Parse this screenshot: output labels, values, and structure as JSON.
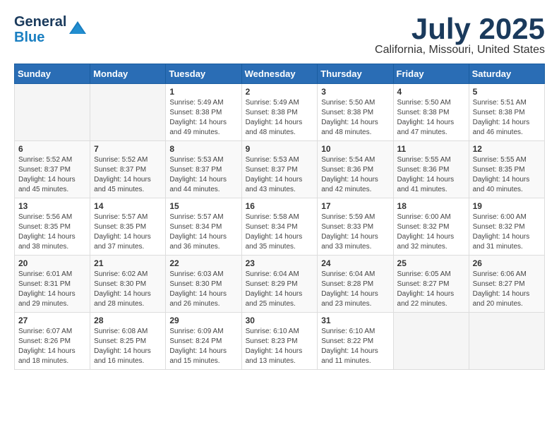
{
  "app": {
    "name": "GeneralBlue",
    "name_part1": "General",
    "name_part2": "Blue"
  },
  "title": {
    "month_year": "July 2025",
    "location": "California, Missouri, United States"
  },
  "weekdays": [
    "Sunday",
    "Monday",
    "Tuesday",
    "Wednesday",
    "Thursday",
    "Friday",
    "Saturday"
  ],
  "weeks": [
    [
      {
        "day": "",
        "info": ""
      },
      {
        "day": "",
        "info": ""
      },
      {
        "day": "1",
        "info": "Sunrise: 5:49 AM\nSunset: 8:38 PM\nDaylight: 14 hours and 49 minutes."
      },
      {
        "day": "2",
        "info": "Sunrise: 5:49 AM\nSunset: 8:38 PM\nDaylight: 14 hours and 48 minutes."
      },
      {
        "day": "3",
        "info": "Sunrise: 5:50 AM\nSunset: 8:38 PM\nDaylight: 14 hours and 48 minutes."
      },
      {
        "day": "4",
        "info": "Sunrise: 5:50 AM\nSunset: 8:38 PM\nDaylight: 14 hours and 47 minutes."
      },
      {
        "day": "5",
        "info": "Sunrise: 5:51 AM\nSunset: 8:38 PM\nDaylight: 14 hours and 46 minutes."
      }
    ],
    [
      {
        "day": "6",
        "info": "Sunrise: 5:52 AM\nSunset: 8:37 PM\nDaylight: 14 hours and 45 minutes."
      },
      {
        "day": "7",
        "info": "Sunrise: 5:52 AM\nSunset: 8:37 PM\nDaylight: 14 hours and 45 minutes."
      },
      {
        "day": "8",
        "info": "Sunrise: 5:53 AM\nSunset: 8:37 PM\nDaylight: 14 hours and 44 minutes."
      },
      {
        "day": "9",
        "info": "Sunrise: 5:53 AM\nSunset: 8:37 PM\nDaylight: 14 hours and 43 minutes."
      },
      {
        "day": "10",
        "info": "Sunrise: 5:54 AM\nSunset: 8:36 PM\nDaylight: 14 hours and 42 minutes."
      },
      {
        "day": "11",
        "info": "Sunrise: 5:55 AM\nSunset: 8:36 PM\nDaylight: 14 hours and 41 minutes."
      },
      {
        "day": "12",
        "info": "Sunrise: 5:55 AM\nSunset: 8:35 PM\nDaylight: 14 hours and 40 minutes."
      }
    ],
    [
      {
        "day": "13",
        "info": "Sunrise: 5:56 AM\nSunset: 8:35 PM\nDaylight: 14 hours and 38 minutes."
      },
      {
        "day": "14",
        "info": "Sunrise: 5:57 AM\nSunset: 8:35 PM\nDaylight: 14 hours and 37 minutes."
      },
      {
        "day": "15",
        "info": "Sunrise: 5:57 AM\nSunset: 8:34 PM\nDaylight: 14 hours and 36 minutes."
      },
      {
        "day": "16",
        "info": "Sunrise: 5:58 AM\nSunset: 8:34 PM\nDaylight: 14 hours and 35 minutes."
      },
      {
        "day": "17",
        "info": "Sunrise: 5:59 AM\nSunset: 8:33 PM\nDaylight: 14 hours and 33 minutes."
      },
      {
        "day": "18",
        "info": "Sunrise: 6:00 AM\nSunset: 8:32 PM\nDaylight: 14 hours and 32 minutes."
      },
      {
        "day": "19",
        "info": "Sunrise: 6:00 AM\nSunset: 8:32 PM\nDaylight: 14 hours and 31 minutes."
      }
    ],
    [
      {
        "day": "20",
        "info": "Sunrise: 6:01 AM\nSunset: 8:31 PM\nDaylight: 14 hours and 29 minutes."
      },
      {
        "day": "21",
        "info": "Sunrise: 6:02 AM\nSunset: 8:30 PM\nDaylight: 14 hours and 28 minutes."
      },
      {
        "day": "22",
        "info": "Sunrise: 6:03 AM\nSunset: 8:30 PM\nDaylight: 14 hours and 26 minutes."
      },
      {
        "day": "23",
        "info": "Sunrise: 6:04 AM\nSunset: 8:29 PM\nDaylight: 14 hours and 25 minutes."
      },
      {
        "day": "24",
        "info": "Sunrise: 6:04 AM\nSunset: 8:28 PM\nDaylight: 14 hours and 23 minutes."
      },
      {
        "day": "25",
        "info": "Sunrise: 6:05 AM\nSunset: 8:27 PM\nDaylight: 14 hours and 22 minutes."
      },
      {
        "day": "26",
        "info": "Sunrise: 6:06 AM\nSunset: 8:27 PM\nDaylight: 14 hours and 20 minutes."
      }
    ],
    [
      {
        "day": "27",
        "info": "Sunrise: 6:07 AM\nSunset: 8:26 PM\nDaylight: 14 hours and 18 minutes."
      },
      {
        "day": "28",
        "info": "Sunrise: 6:08 AM\nSunset: 8:25 PM\nDaylight: 14 hours and 16 minutes."
      },
      {
        "day": "29",
        "info": "Sunrise: 6:09 AM\nSunset: 8:24 PM\nDaylight: 14 hours and 15 minutes."
      },
      {
        "day": "30",
        "info": "Sunrise: 6:10 AM\nSunset: 8:23 PM\nDaylight: 14 hours and 13 minutes."
      },
      {
        "day": "31",
        "info": "Sunrise: 6:10 AM\nSunset: 8:22 PM\nDaylight: 14 hours and 11 minutes."
      },
      {
        "day": "",
        "info": ""
      },
      {
        "day": "",
        "info": ""
      }
    ]
  ]
}
